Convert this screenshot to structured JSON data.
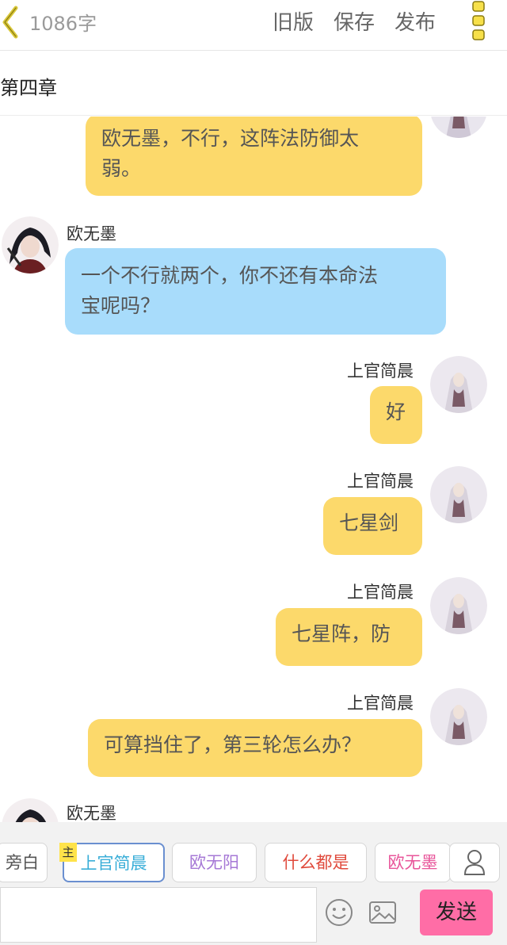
{
  "header": {
    "word_count": "1086字",
    "old_version": "旧版",
    "save": "保存",
    "publish": "发布"
  },
  "chapter": {
    "title": "第四章"
  },
  "messages": [
    {
      "side": "right",
      "name": "",
      "text_lines": [
        "欧无墨，不行，这阵法防御太",
        "弱。"
      ],
      "color": "yellow"
    },
    {
      "side": "left",
      "name": "欧无墨",
      "text_lines": [
        "一个不行就两个，你不还有本命法",
        "宝呢吗？"
      ],
      "color": "blue"
    },
    {
      "side": "right",
      "name": "上官简晨",
      "text_lines": [
        "好"
      ],
      "color": "yellow"
    },
    {
      "side": "right",
      "name": "上官简晨",
      "text_lines": [
        "七星剑"
      ],
      "color": "yellow"
    },
    {
      "side": "right",
      "name": "上官简晨",
      "text_lines": [
        "七星阵，防"
      ],
      "color": "yellow"
    },
    {
      "side": "right",
      "name": "上官简晨",
      "text_lines": [
        "可算挡住了，第三轮怎么办？"
      ],
      "color": "yellow"
    },
    {
      "side": "left",
      "name": "欧无墨",
      "text_lines": [],
      "color": "blue"
    }
  ],
  "roles": {
    "main_tag": "主",
    "items": [
      {
        "label": "旁白",
        "color": "#555555"
      },
      {
        "label": "上官简晨",
        "color": "#3aaed8"
      },
      {
        "label": "欧无阳",
        "color": "#a678d6"
      },
      {
        "label": "什么都是",
        "color": "#e04a3c"
      },
      {
        "label": "欧无墨",
        "color": "#e8559a"
      }
    ]
  },
  "input": {
    "value": "",
    "send_label": "发送"
  },
  "icons": {
    "back": "chevron-left-icon",
    "more": "more-vertical-icon",
    "user": "user-icon",
    "emoji": "emoji-icon",
    "image": "image-icon"
  }
}
